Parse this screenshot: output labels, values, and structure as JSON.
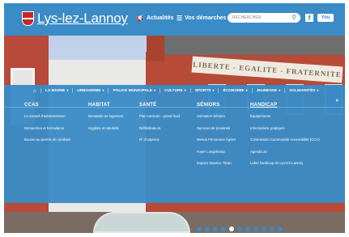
{
  "header": {
    "logo_text": "Lys-lez-Lannoy",
    "actualites": "Actualités",
    "demarches": "Vos démarches",
    "search_placeholder": "RECHERCHER",
    "facebook": "f",
    "youtube": "You Tube"
  },
  "hero": {
    "sign_text": "LIBERTE - EGALITE - FRATERNITE",
    "slides_count": 11,
    "active_slide": 4
  },
  "nav": {
    "items": [
      "LA MAIRIE",
      "URBANISME",
      "POLICE MUNICIPALE",
      "CULTURE",
      "SPORTS",
      "ÉCONOMIE",
      "JEUNESSE",
      "SOLIDARITÉS"
    ]
  },
  "menu": {
    "close": "×",
    "columns": [
      {
        "title": "CCAS",
        "links": [
          "Le conseil d'administration",
          "Démarches et formulaires",
          "Bourse au permis de conduire"
        ]
      },
      {
        "title": "HABITAT",
        "links": [
          "Demande de logement",
          "Hygiène et salubrité"
        ]
      },
      {
        "title": "SANTÉ",
        "links": [
          "Plan canicule - grand froid",
          "Défibrillateurs",
          "N° d'urgence"
        ]
      },
      {
        "title": "SÉNIORS",
        "links": [
          "Animation Séniors",
          "Services de proximité",
          "Menus Personnes Âgées",
          "Foyer Longchamp",
          "Espace Maurice Titran"
        ]
      },
      {
        "title": "HANDICAP",
        "links": [
          "Equipements",
          "Informations pratiques",
          "Commission Communale Accessibilité (CCA)",
          "Agenda 22",
          "Label handicap de Lys-lez-Lannoy"
        ]
      }
    ]
  },
  "colors": {
    "brand": "#3a8bc6"
  }
}
